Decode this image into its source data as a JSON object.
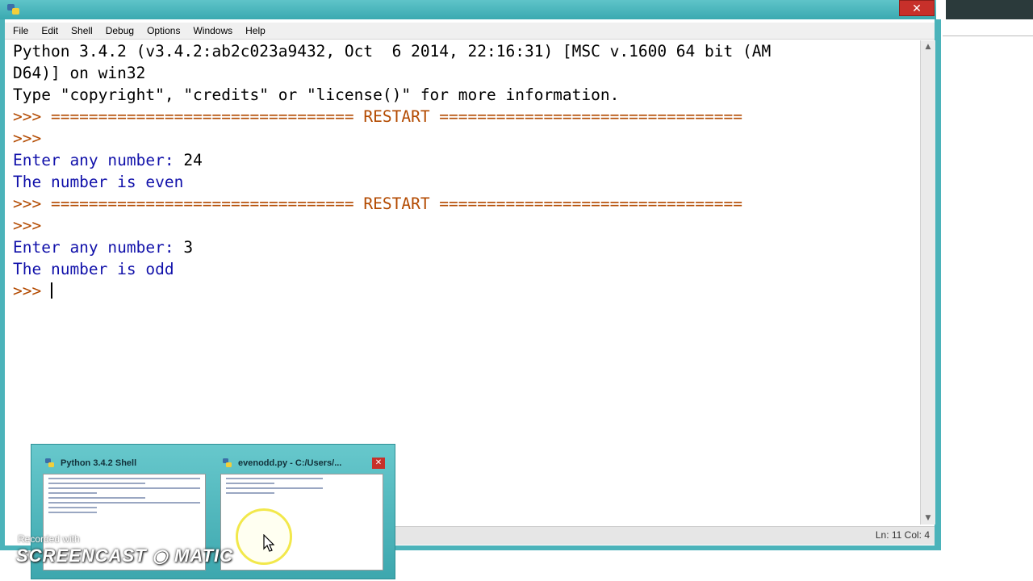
{
  "window": {
    "close_glyph": "✕"
  },
  "menu": {
    "items": [
      "File",
      "Edit",
      "Shell",
      "Debug",
      "Options",
      "Windows",
      "Help"
    ]
  },
  "shell": {
    "lines": [
      {
        "text": "Python 3.4.2 (v3.4.2:ab2c023a9432, Oct  6 2014, 22:16:31) [MSC v.1600 64 bit (AM",
        "color": "black"
      },
      {
        "text": "D64)] on win32",
        "color": "black"
      },
      {
        "text": "Type \"copyright\", \"credits\" or \"license()\" for more information.",
        "color": "black"
      },
      {
        "text": ">>> ================================ RESTART ================================",
        "color": "prompt"
      },
      {
        "text": ">>> ",
        "color": "prompt"
      },
      {
        "text": "Enter any number: 24",
        "color": "mixed",
        "label": "Enter any number: ",
        "input": "24"
      },
      {
        "text": "The number is even",
        "color": "blue"
      },
      {
        "text": ">>> ================================ RESTART ================================",
        "color": "prompt"
      },
      {
        "text": ">>> ",
        "color": "prompt"
      },
      {
        "text": "Enter any number: 3",
        "color": "mixed",
        "label": "Enter any number: ",
        "input": "3"
      },
      {
        "text": "The number is odd",
        "color": "blue"
      },
      {
        "text": ">>> ",
        "color": "prompt",
        "caret": true
      }
    ]
  },
  "status": {
    "position": "Ln: 11  Col: 4"
  },
  "taskbar_popup": {
    "thumb1_title": "Python 3.4.2 Shell",
    "thumb2_title": "evenodd.py - C:/Users/...",
    "close_glyph": "✕"
  },
  "watermark": {
    "small": "Recorded with",
    "big": "SCREENCAST ◉ MATIC"
  },
  "colors": {
    "frame": "#4bb3ba",
    "output_blue": "#1111aa",
    "prompt": "#b34a00",
    "close_red": "#c7302a"
  }
}
